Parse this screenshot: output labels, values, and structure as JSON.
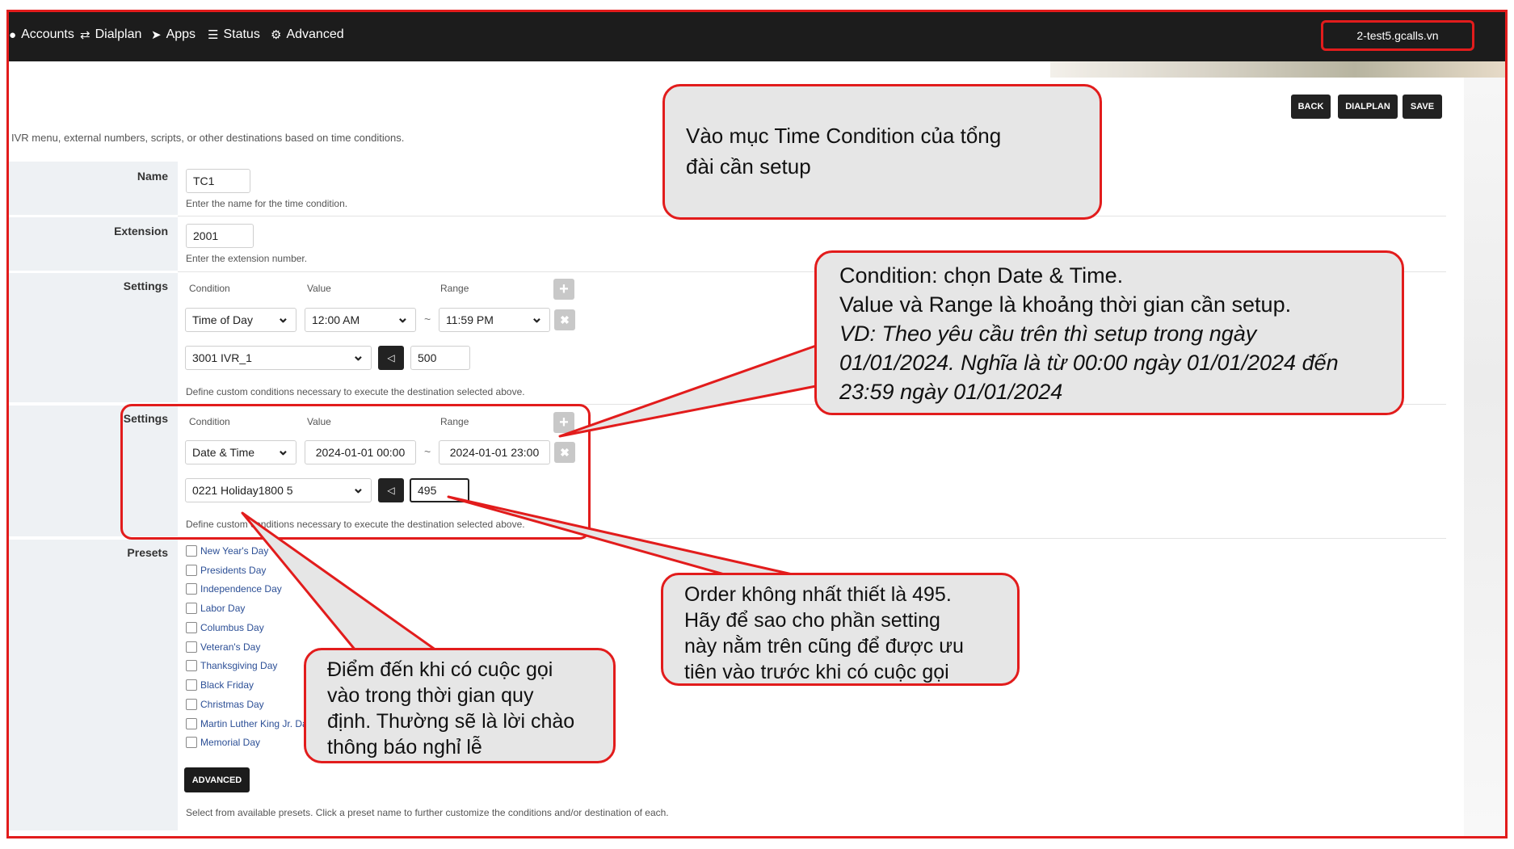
{
  "nav": [
    {
      "label": "Accounts",
      "icon": "user-icon"
    },
    {
      "label": "Dialplan",
      "icon": "arrows-swap-icon"
    },
    {
      "label": "Apps",
      "icon": "send-icon"
    },
    {
      "label": "Status",
      "icon": "sliders-icon"
    },
    {
      "label": "Advanced",
      "icon": "gear-icon"
    }
  ],
  "host": "2-test5.gcalls.vn",
  "page": {
    "description": "IVR menu, external numbers, scripts, or other destinations based on time conditions.",
    "buttons": {
      "back": "BACK",
      "dialplan": "DIALPLAN",
      "save": "SAVE"
    }
  },
  "form": {
    "name": {
      "label": "Name",
      "value": "TC1",
      "hint": "Enter the name for the time condition."
    },
    "extension": {
      "label": "Extension",
      "value": "2001",
      "hint": "Enter the extension number."
    },
    "settings1": {
      "label": "Settings",
      "col_condition": "Condition",
      "col_value": "Value",
      "col_range": "Range",
      "condition": "Time of Day",
      "value": "12:00 AM",
      "range": "11:59 PM",
      "destination": "3001 IVR_1",
      "order": "500",
      "hint": "Define custom conditions necessary to execute the destination selected above."
    },
    "settings2": {
      "label": "Settings",
      "col_condition": "Condition",
      "col_value": "Value",
      "col_range": "Range",
      "condition": "Date & Time",
      "value": "2024-01-01 00:00",
      "range": "2024-01-01 23:00",
      "destination": "0221 Holiday1800 5",
      "order": "495",
      "hint": "Define custom conditions necessary to execute the destination selected above."
    },
    "presets": {
      "label": "Presets",
      "items": [
        "New Year's Day",
        "Presidents Day",
        "Independence Day",
        "Labor Day",
        "Columbus Day",
        "Veteran's Day",
        "Thanksgiving Day",
        "Black Friday",
        "Christmas Day",
        "Martin Luther King Jr. Day",
        "Memorial Day"
      ],
      "advanced": "ADVANCED",
      "hint": "Select from available presets. Click a preset name to further customize the conditions and/or destination of each."
    },
    "tilde": "~",
    "plus": "+",
    "remove": "✖",
    "arrow": "◁"
  },
  "callouts": {
    "c1": [
      "Vào mục Time Condition của tổng",
      "đài cần setup"
    ],
    "c2": [
      "Condition: chọn Date & Time.",
      "Value và Range là khoảng thời gian cần setup."
    ],
    "c2_italic": [
      "VD: Theo yêu cầu trên thì setup trong ngày",
      "01/01/2024. Nghĩa là từ 00:00 ngày 01/01/2024 đến",
      "23:59 ngày 01/01/2024"
    ],
    "c3": [
      "Order không nhất thiết là 495.",
      "Hãy để sao cho phần setting",
      "này nằm trên cũng để được ưu",
      "tiên vào trước khi có cuộc gọi"
    ],
    "c4": [
      "Điểm đến khi có cuộc gọi",
      "vào trong thời gian quy",
      "định. Thường sẽ là lời chào",
      "thông báo nghỉ lễ"
    ]
  },
  "colors": {
    "accent": "#e21c1c",
    "topbar": "#1c1c1c",
    "callout_bg": "#e6e6e6",
    "link": "#2c4f96"
  }
}
